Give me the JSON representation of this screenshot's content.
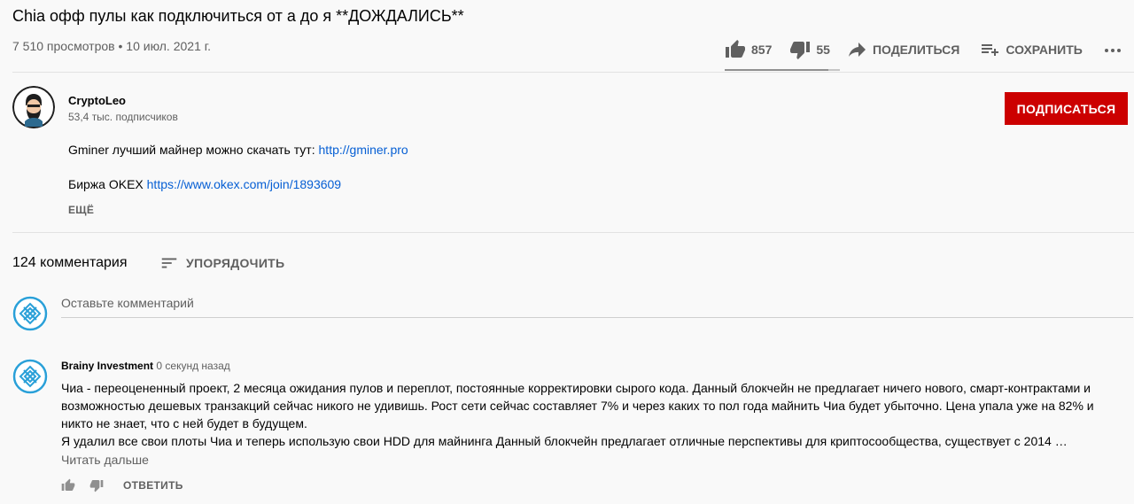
{
  "video": {
    "title": "Chia офф пулы как подключиться от а до я **ДОЖДАЛИСЬ**",
    "meta": "7 510 просмотров • 10 июл. 2021 г."
  },
  "actions": {
    "likes": "857",
    "dislikes": "55",
    "share_label": "ПОДЕЛИТЬСЯ",
    "save_label": "СОХРАНИТЬ",
    "like_ratio": 0.94
  },
  "channel": {
    "name": "CryptoLeo",
    "subscribers": "53,4 тыс. подписчиков",
    "subscribe_label": "ПОДПИСАТЬСЯ"
  },
  "description": {
    "line1_text": "Gminer лучший майнер можно скачать тут: ",
    "line1_link": "http://gminer.pro",
    "line2_text": "Биржа OKEX ",
    "line2_link": "https://www.okex.com/join/1893609",
    "more_label": "ЕЩЁ"
  },
  "comments": {
    "count": "124 комментария",
    "sort_label": "УПОРЯДОЧИТЬ",
    "input_placeholder": "Оставьте комментарий",
    "items": [
      {
        "author": "Brainy Investment",
        "time": "0 секунд назад",
        "text1": "Чиа - переоцененный проект, 2 месяца ожидания пулов и переплот, постоянные корректировки сырого кода. Данный блокчейн не предлагает ничего нового, смарт-контрактами и возможностью дешевых транзакций сейчас никого не удивишь. Рост сети сейчас составляет 7% и через каких то пол года майнить Чиа будет убыточно. Цена упала уже на 82% и никто не знает, что с ней будет в будущем.",
        "text2": "Я удалил все свои плоты Чиа и теперь использую свои HDD для майнинга Данный блокчейн предлагает отличные перспективы для криптосообщества, существует с 2014 …",
        "read_more": "Читать дальше",
        "reply_label": "ОТВЕТИТЬ"
      }
    ]
  },
  "icons": [
    "thumb-up-icon",
    "thumb-down-icon",
    "share-icon",
    "playlist-add-icon",
    "more-icon",
    "sort-icon"
  ]
}
